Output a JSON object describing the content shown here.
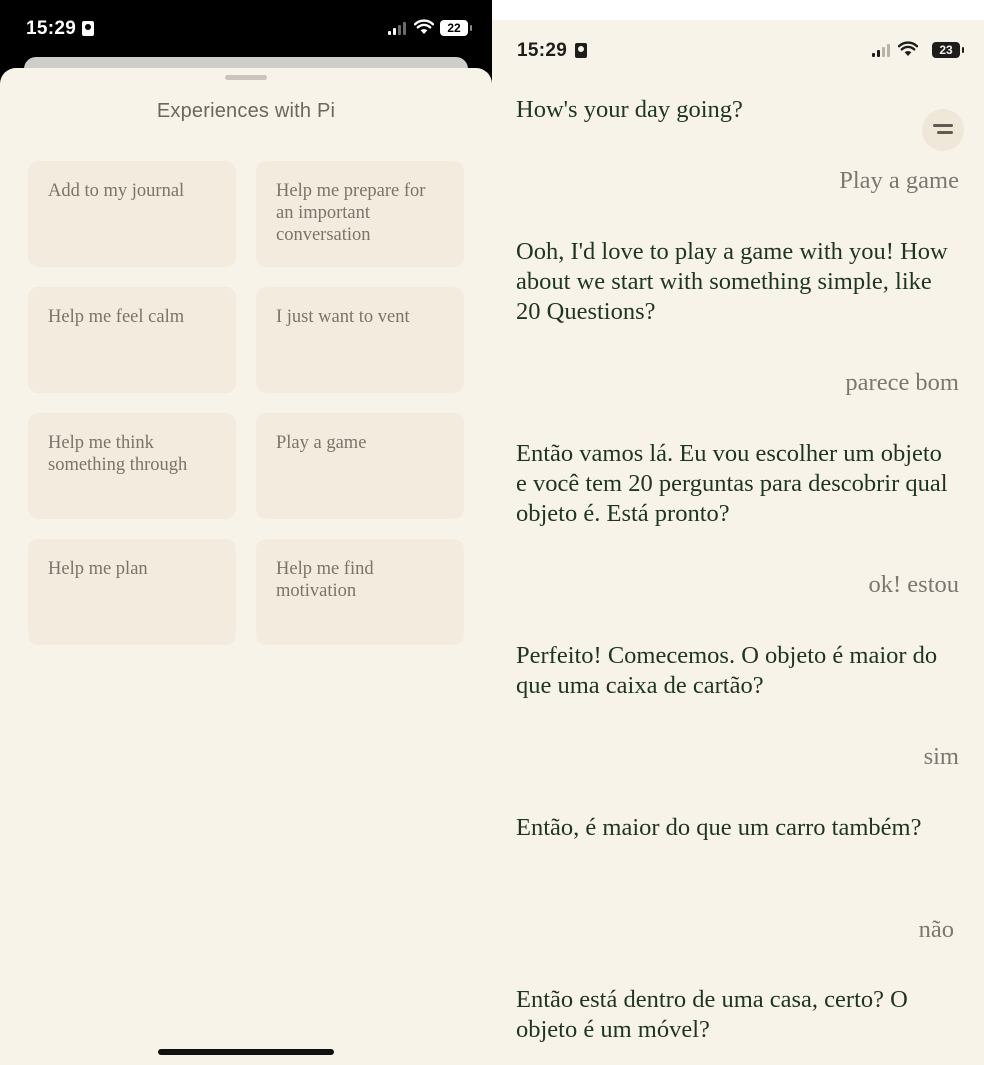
{
  "left_screen": {
    "status_bar": {
      "time": "15:29",
      "battery": "22"
    },
    "sheet_title": "Experiences with Pi",
    "cards": [
      {
        "label": "Add to my journal"
      },
      {
        "label": "Help me prepare for an important conversation"
      },
      {
        "label": "Help me feel calm"
      },
      {
        "label": "I just want to vent"
      },
      {
        "label": "Help me think something through"
      },
      {
        "label": "Play a game"
      },
      {
        "label": "Help me plan"
      },
      {
        "label": "Help me find motivation"
      }
    ]
  },
  "right_screen": {
    "status_bar": {
      "time": "15:29",
      "battery": "23"
    },
    "messages": [
      {
        "from": "pi",
        "text": "How's your day going?"
      },
      {
        "from": "user",
        "text": "Play a game"
      },
      {
        "from": "pi",
        "text": "Ooh, I'd love to play a game with you! How about we start with something simple, like 20 Questions?"
      },
      {
        "from": "user",
        "text": "parece bom"
      },
      {
        "from": "pi",
        "text": "Então vamos lá. Eu vou escolher um objeto e você tem 20 perguntas para descobrir qual objeto é. Está pronto?"
      },
      {
        "from": "user",
        "text": "ok! estou"
      },
      {
        "from": "pi",
        "text": "Perfeito! Comecemos. O objeto é maior do que uma caixa de cartão?"
      },
      {
        "from": "user",
        "text": "sim"
      },
      {
        "from": "pi",
        "text": "Então, é maior do que um carro também?"
      },
      {
        "from": "user",
        "text": "não"
      },
      {
        "from": "pi",
        "text": "Então está dentro de uma casa, certo? O objeto é um móvel?"
      }
    ]
  }
}
